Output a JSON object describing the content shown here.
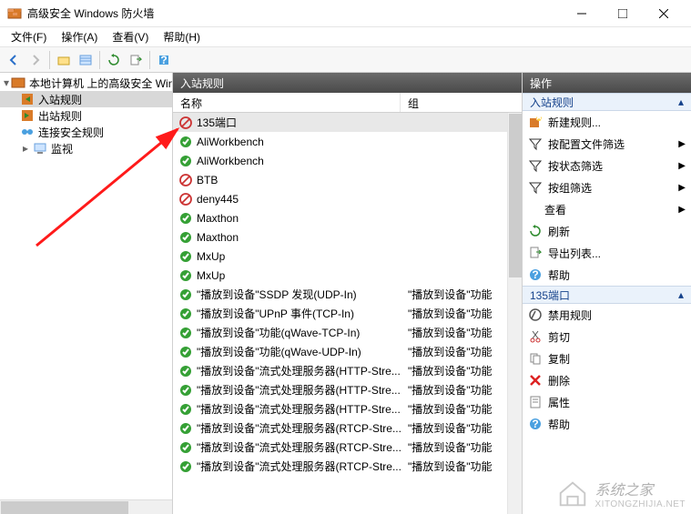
{
  "window": {
    "title": "高级安全 Windows 防火墙"
  },
  "menu": {
    "file": "文件(F)",
    "action": "操作(A)",
    "view": "查看(V)",
    "help": "帮助(H)"
  },
  "tree": {
    "root": "本地计算机 上的高级安全 Win",
    "inbound": "入站规则",
    "outbound": "出站规则",
    "connsec": "连接安全规则",
    "monitor": "监视"
  },
  "center": {
    "title": "入站规则",
    "col_name": "名称",
    "col_group": "组",
    "rows": [
      {
        "icon": "block",
        "name": "135端口",
        "group": "",
        "selected": true
      },
      {
        "icon": "allow",
        "name": "AliWorkbench",
        "group": ""
      },
      {
        "icon": "allow",
        "name": "AliWorkbench",
        "group": ""
      },
      {
        "icon": "block",
        "name": "BTB",
        "group": ""
      },
      {
        "icon": "block",
        "name": "deny445",
        "group": ""
      },
      {
        "icon": "allow",
        "name": "Maxthon",
        "group": ""
      },
      {
        "icon": "allow",
        "name": "Maxthon",
        "group": ""
      },
      {
        "icon": "allow",
        "name": "MxUp",
        "group": ""
      },
      {
        "icon": "allow",
        "name": "MxUp",
        "group": ""
      },
      {
        "icon": "allow",
        "name": "\"播放到设备\"SSDP 发现(UDP-In)",
        "group": "\"播放到设备\"功能"
      },
      {
        "icon": "allow",
        "name": "\"播放到设备\"UPnP 事件(TCP-In)",
        "group": "\"播放到设备\"功能"
      },
      {
        "icon": "allow",
        "name": "\"播放到设备\"功能(qWave-TCP-In)",
        "group": "\"播放到设备\"功能"
      },
      {
        "icon": "allow",
        "name": "\"播放到设备\"功能(qWave-UDP-In)",
        "group": "\"播放到设备\"功能"
      },
      {
        "icon": "allow",
        "name": "\"播放到设备\"流式处理服务器(HTTP-Stre...",
        "group": "\"播放到设备\"功能"
      },
      {
        "icon": "allow",
        "name": "\"播放到设备\"流式处理服务器(HTTP-Stre...",
        "group": "\"播放到设备\"功能"
      },
      {
        "icon": "allow",
        "name": "\"播放到设备\"流式处理服务器(HTTP-Stre...",
        "group": "\"播放到设备\"功能"
      },
      {
        "icon": "allow",
        "name": "\"播放到设备\"流式处理服务器(RTCP-Stre...",
        "group": "\"播放到设备\"功能"
      },
      {
        "icon": "allow",
        "name": "\"播放到设备\"流式处理服务器(RTCP-Stre...",
        "group": "\"播放到设备\"功能"
      },
      {
        "icon": "allow",
        "name": "\"播放到设备\"流式处理服务器(RTCP-Stre...",
        "group": "\"播放到设备\"功能"
      }
    ]
  },
  "actions": {
    "header": "操作",
    "section1": "入站规则",
    "new_rule": "新建规则...",
    "filter_profile": "按配置文件筛选",
    "filter_state": "按状态筛选",
    "filter_group": "按组筛选",
    "view": "查看",
    "refresh": "刷新",
    "export": "导出列表...",
    "help": "帮助",
    "section2": "135端口",
    "disable": "禁用规则",
    "cut": "剪切",
    "copy": "复制",
    "delete": "删除",
    "properties": "属性",
    "help2": "帮助"
  },
  "watermark": {
    "text": "系统之家",
    "sub": "XITONGZHIJIA.NET"
  }
}
